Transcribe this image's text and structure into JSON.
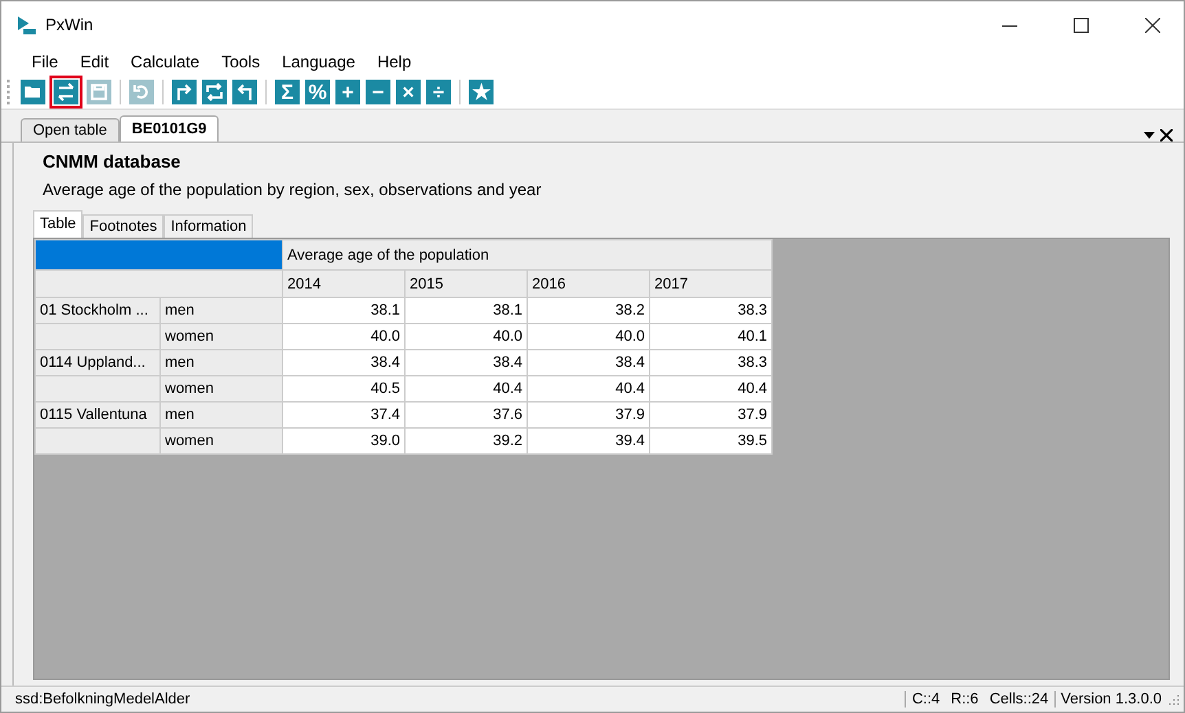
{
  "window": {
    "title": "PxWin"
  },
  "menu": [
    "File",
    "Edit",
    "Calculate",
    "Tools",
    "Language",
    "Help"
  ],
  "toolbar": {
    "groups": [
      [
        {
          "kind": "open",
          "selected": false,
          "disabled": false
        },
        {
          "kind": "pivot",
          "selected": true,
          "disabled": false
        },
        {
          "kind": "save",
          "selected": false,
          "disabled": true
        }
      ],
      [
        {
          "kind": "undo",
          "selected": false,
          "disabled": true
        }
      ],
      [
        {
          "kind": "pivot-cw",
          "selected": false,
          "disabled": false
        },
        {
          "kind": "rotate",
          "selected": false,
          "disabled": false
        },
        {
          "kind": "pivot-ccw",
          "selected": false,
          "disabled": false
        }
      ],
      [
        {
          "kind": "glyph",
          "glyph": "Σ",
          "selected": false,
          "disabled": false
        },
        {
          "kind": "glyph",
          "glyph": "%",
          "selected": false,
          "disabled": false
        },
        {
          "kind": "glyph",
          "glyph": "+",
          "selected": false,
          "disabled": false
        },
        {
          "kind": "glyph",
          "glyph": "−",
          "selected": false,
          "disabled": false
        },
        {
          "kind": "glyph",
          "glyph": "×",
          "selected": false,
          "disabled": false
        },
        {
          "kind": "glyph",
          "glyph": "÷",
          "selected": false,
          "disabled": false
        }
      ],
      [
        {
          "kind": "glyph",
          "glyph": "★",
          "selected": false,
          "disabled": false
        }
      ]
    ]
  },
  "doc_tabs": [
    {
      "label": "Open table",
      "selected": false
    },
    {
      "label": "BE0101G9",
      "selected": true
    }
  ],
  "database": "CNMM database",
  "description": "Average age of the population by region, sex, observations and year",
  "view_tabs": [
    {
      "label": "Table",
      "selected": true
    },
    {
      "label": "Footnotes",
      "selected": false
    },
    {
      "label": "Information",
      "selected": false
    }
  ],
  "table": {
    "heading": "Average age of the population",
    "years": [
      "2014",
      "2015",
      "2016",
      "2017"
    ],
    "rows": [
      {
        "region": "01 Stockholm ...",
        "sex": "men",
        "values": [
          "38.1",
          "38.1",
          "38.2",
          "38.3"
        ]
      },
      {
        "region": "",
        "sex": "women",
        "values": [
          "40.0",
          "40.0",
          "40.0",
          "40.1"
        ]
      },
      {
        "region": "0114 Uppland...",
        "sex": "men",
        "values": [
          "38.4",
          "38.4",
          "38.4",
          "38.3"
        ]
      },
      {
        "region": "",
        "sex": "women",
        "values": [
          "40.5",
          "40.4",
          "40.4",
          "40.4"
        ]
      },
      {
        "region": "0115 Vallentuna",
        "sex": "men",
        "values": [
          "37.4",
          "37.6",
          "37.9",
          "37.9"
        ]
      },
      {
        "region": "",
        "sex": "women",
        "values": [
          "39.0",
          "39.2",
          "39.4",
          "39.5"
        ]
      }
    ]
  },
  "status_bar": {
    "source": "ssd:BefolkningMedelAlder",
    "columns": "C::4",
    "rows": "R::6",
    "cells": "Cells::24",
    "version": "Version 1.3.0.0"
  }
}
